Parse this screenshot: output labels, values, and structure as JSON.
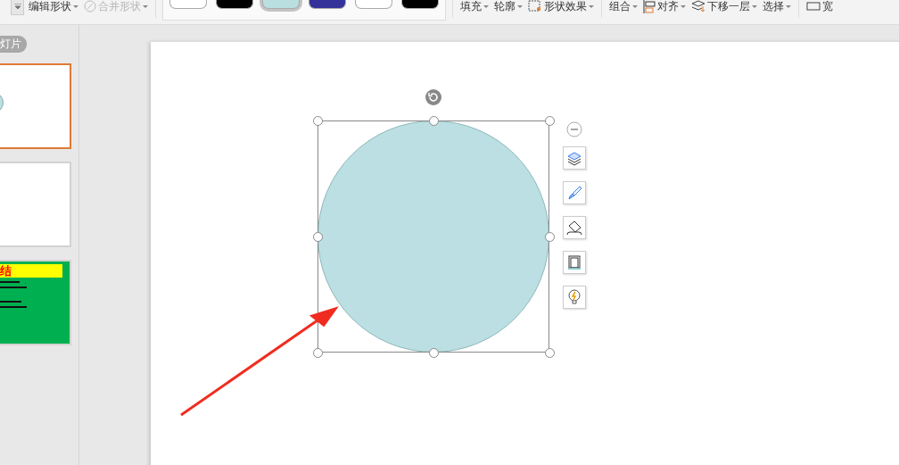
{
  "ribbon": {
    "edit_shape": {
      "label": "编辑形状",
      "disabled": false
    },
    "merge_shape": {
      "label": "合并形状",
      "disabled": true
    },
    "swatches": [
      {
        "color": "#ffffff",
        "selected": false
      },
      {
        "color": "#000000",
        "selected": false
      },
      {
        "color": "#b9dfe1",
        "selected": true
      },
      {
        "color": "#33339a",
        "selected": false
      },
      {
        "color": "#ffffff",
        "selected": false
      },
      {
        "color": "#000000",
        "selected": false
      }
    ],
    "format_tools": [
      {
        "label": "填充"
      },
      {
        "label": "轮廓"
      },
      {
        "label": "形状效果"
      }
    ],
    "arrange_tools": [
      {
        "label": "组合"
      },
      {
        "label": "对齐"
      },
      {
        "label": "下移一层"
      },
      {
        "label": "选择"
      }
    ],
    "size_tool": {
      "label": "宽"
    }
  },
  "slide_panel": {
    "tab_label": "灯片",
    "thumbnails": [
      {
        "kind": "circle",
        "selected": true
      },
      {
        "kind": "blank",
        "selected": false
      },
      {
        "kind": "title",
        "title": "结",
        "selected": false
      }
    ]
  },
  "canvas": {
    "shape": {
      "kind": "circle",
      "color": "#bbdfe2",
      "selected": true
    },
    "side_tools": [
      {
        "kind": "layers"
      },
      {
        "kind": "brush"
      },
      {
        "kind": "fill"
      },
      {
        "kind": "outline"
      },
      {
        "kind": "idea"
      }
    ],
    "annotation": {
      "kind": "arrow",
      "color": "#f02c20"
    }
  }
}
